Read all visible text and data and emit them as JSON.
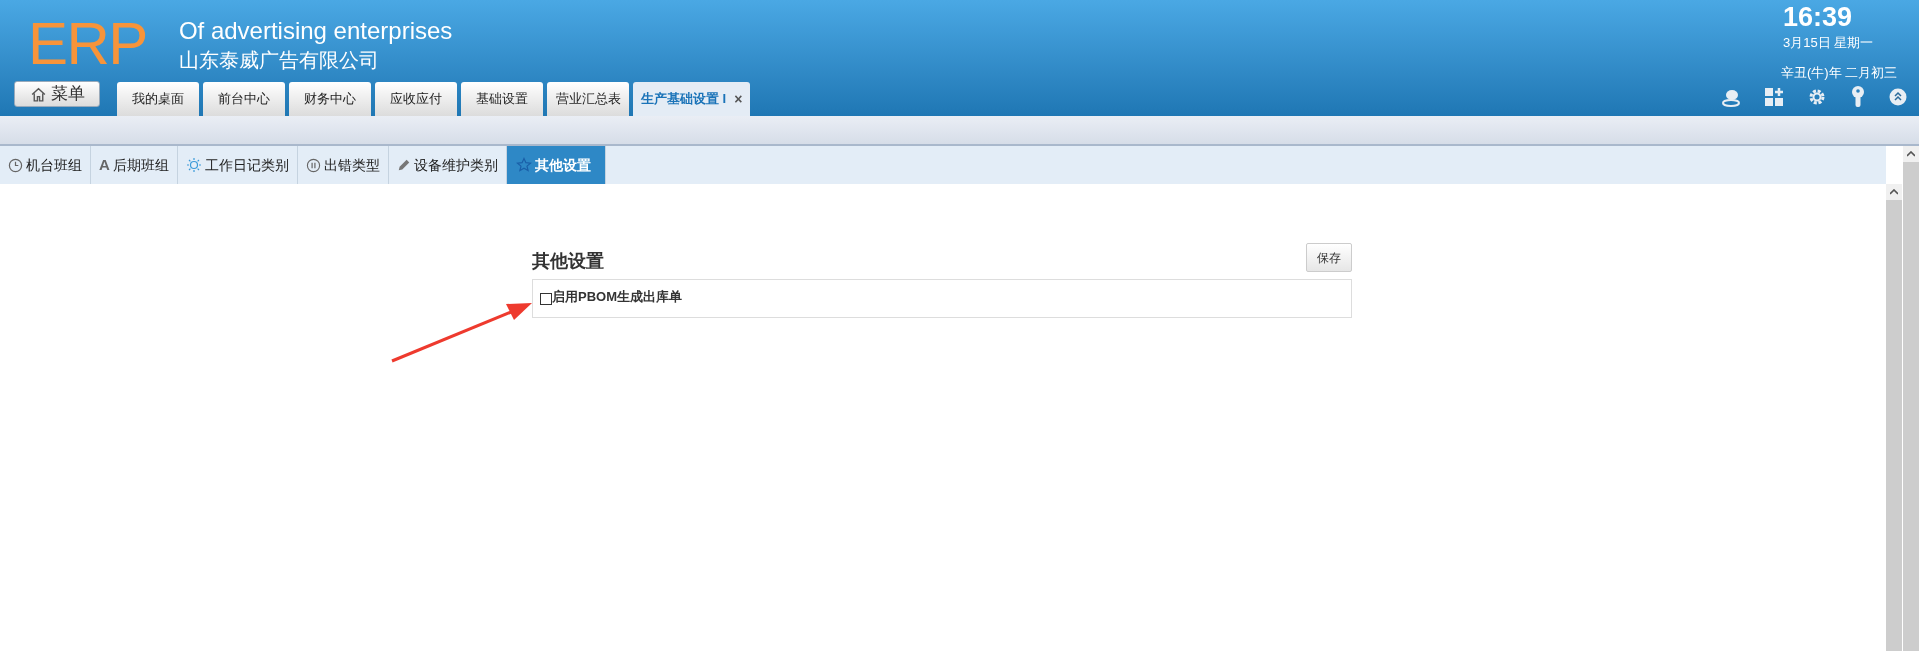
{
  "header": {
    "logo": "ERP",
    "title": "Of advertising enterprises",
    "company": "山东泰威广告有限公司",
    "time": "16:39",
    "date": "3月15日 星期一",
    "lunar_date": "辛丑(牛)年 二月初三"
  },
  "menu_button": {
    "label": "菜单"
  },
  "nav_tabs": [
    {
      "label": "我的桌面",
      "selected": false
    },
    {
      "label": "前台中心",
      "selected": false
    },
    {
      "label": "财务中心",
      "selected": false
    },
    {
      "label": "应收应付",
      "selected": false
    },
    {
      "label": "基础设置",
      "selected": false
    },
    {
      "label": "营业汇总表",
      "selected": false
    },
    {
      "label": "生产基础设置 I",
      "selected": true,
      "close": "×"
    }
  ],
  "sub_tabs": [
    {
      "label": "机台班组",
      "selected": false
    },
    {
      "label": "后期班组",
      "glyph": "A",
      "selected": false
    },
    {
      "label": "工作日记类别",
      "selected": false
    },
    {
      "label": "出错类型",
      "selected": false
    },
    {
      "label": "设备维护类别",
      "selected": false
    },
    {
      "label": "其他设置",
      "selected": true
    }
  ],
  "section": {
    "title": "其他设置",
    "save_button": "保存",
    "options": [
      {
        "label": "启用PBOM生成出库单",
        "checked": false
      }
    ]
  }
}
